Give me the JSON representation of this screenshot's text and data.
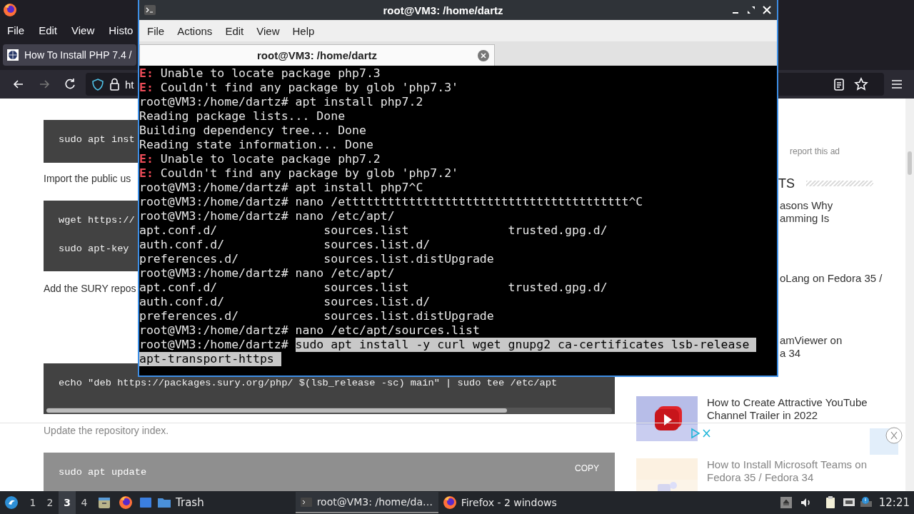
{
  "browser": {
    "menu": [
      "File",
      "Edit",
      "View",
      "Histo"
    ],
    "tab": {
      "title": "How To Install PHP 7.4 /"
    },
    "url": {
      "value": "ht"
    },
    "article": [
      {
        "kind": "code",
        "lines": [
          "sudo apt inst"
        ],
        "dimmed": false
      },
      {
        "kind": "text",
        "text": "Import the public us",
        "dimmed": false
      },
      {
        "kind": "code",
        "lines": [
          "wget https://",
          "sudo apt-key"
        ],
        "dimmed": false
      },
      {
        "kind": "text",
        "text": "Add the SURY repos",
        "dimmed": false
      },
      {
        "kind": "code",
        "lines": [
          "echo \"deb https://packages.sury.org/php/ $(lsb_release -sc) main\" | sudo tee /etc/apt"
        ],
        "dimmed": false,
        "scrollable": true
      },
      {
        "kind": "text",
        "text": "Update the repository index.",
        "dimmed": true
      },
      {
        "kind": "code",
        "lines": [
          "sudo apt update"
        ],
        "dimmed": true,
        "copy": "COPY"
      }
    ],
    "sidebar": {
      "note": "report this ad",
      "heading": "TS",
      "posts": [
        {
          "kind": "plain",
          "lines": [
            "asons Why",
            "amming Is"
          ],
          "dimmed": false
        },
        {
          "kind": "plain",
          "lines": [
            "oLang on Fedora 35 /"
          ],
          "dimmed": false
        },
        {
          "kind": "plain",
          "lines": [
            "amViewer on",
            "a 34"
          ],
          "dimmed": false
        },
        {
          "kind": "thumbnail",
          "lines": [
            "How to Create Attractive YouTube",
            "Channel Trailer in 2022"
          ],
          "dimmed": false
        },
        {
          "kind": "thumbnail",
          "lines": [
            "How to Install Microsoft Teams on",
            "Fedora 35 / Fedora 34"
          ],
          "dimmed": true
        }
      ]
    }
  },
  "terminal": {
    "title": "root@VM3: /home/dartz",
    "menu": [
      "File",
      "Actions",
      "Edit",
      "View",
      "Help"
    ],
    "tabs": [
      {
        "label": "root@VM3: /home/dartz",
        "selected": true
      }
    ],
    "lines": [
      {
        "kind": "error",
        "label": "E:",
        "text": "Unable to locate package php7.3",
        "selected": false
      },
      {
        "kind": "error",
        "label": "E:",
        "text": "Couldn't find any package by glob 'php7.3'",
        "selected": false
      },
      {
        "kind": "prompt",
        "label": "root@VM3:/home/dartz#",
        "text": "apt install php7.2",
        "selected": false
      },
      {
        "kind": "output",
        "text": "Reading package lists... Done",
        "selected": false
      },
      {
        "kind": "output",
        "text": "Building dependency tree... Done",
        "selected": false
      },
      {
        "kind": "output",
        "text": "Reading state information... Done",
        "selected": false
      },
      {
        "kind": "error",
        "label": "E:",
        "text": "Unable to locate package php7.2",
        "selected": false
      },
      {
        "kind": "error",
        "label": "E:",
        "text": "Couldn't find any package by glob 'php7.2'",
        "selected": false
      },
      {
        "kind": "prompt",
        "label": "root@VM3:/home/dartz#",
        "text": "apt install php7^C",
        "selected": false
      },
      {
        "kind": "prompt",
        "label": "root@VM3:/home/dartz#",
        "text": "nano /etttttttttttttttttttttttttttttttttttttttt^C",
        "selected": false
      },
      {
        "kind": "prompt",
        "label": "root@VM3:/home/dartz#",
        "text": "nano /etc/apt/",
        "selected": false
      },
      {
        "kind": "output",
        "text": "apt.conf.d/               sources.list              trusted.gpg.d/",
        "selected": false
      },
      {
        "kind": "output",
        "text": "auth.conf.d/              sources.list.d/",
        "selected": false
      },
      {
        "kind": "output",
        "text": "preferences.d/            sources.list.distUpgrade",
        "selected": false
      },
      {
        "kind": "prompt",
        "label": "root@VM3:/home/dartz#",
        "text": "nano /etc/apt/",
        "selected": false
      },
      {
        "kind": "output",
        "text": "apt.conf.d/               sources.list              trusted.gpg.d/",
        "selected": false
      },
      {
        "kind": "output",
        "text": "auth.conf.d/              sources.list.d/",
        "selected": false
      },
      {
        "kind": "output",
        "text": "preferences.d/            sources.list.distUpgrade",
        "selected": false
      },
      {
        "kind": "prompt",
        "label": "root@VM3:/home/dartz#",
        "text": "nano /etc/apt/sources.list",
        "selected": false
      },
      {
        "kind": "prompt",
        "label": "root@VM3:/home/dartz#",
        "text": "sudo apt install -y curl wget gnupg2 ca-certificates lsb-release ",
        "selected": true
      },
      {
        "kind": "output",
        "text": "apt-transport-https ",
        "selected": true
      }
    ]
  },
  "taskbar": {
    "workspaces": [
      {
        "label": "1",
        "selected": false
      },
      {
        "label": "2",
        "selected": false
      },
      {
        "label": "3",
        "selected": true
      },
      {
        "label": "4",
        "selected": false
      }
    ],
    "trash": "Trash",
    "tasks": [
      {
        "kind": "terminal",
        "title": "root@VM3: /home/da…",
        "selected": true
      },
      {
        "kind": "browser",
        "title": "Firefox - 2 windows",
        "selected": false
      }
    ],
    "clock": "12:21"
  }
}
